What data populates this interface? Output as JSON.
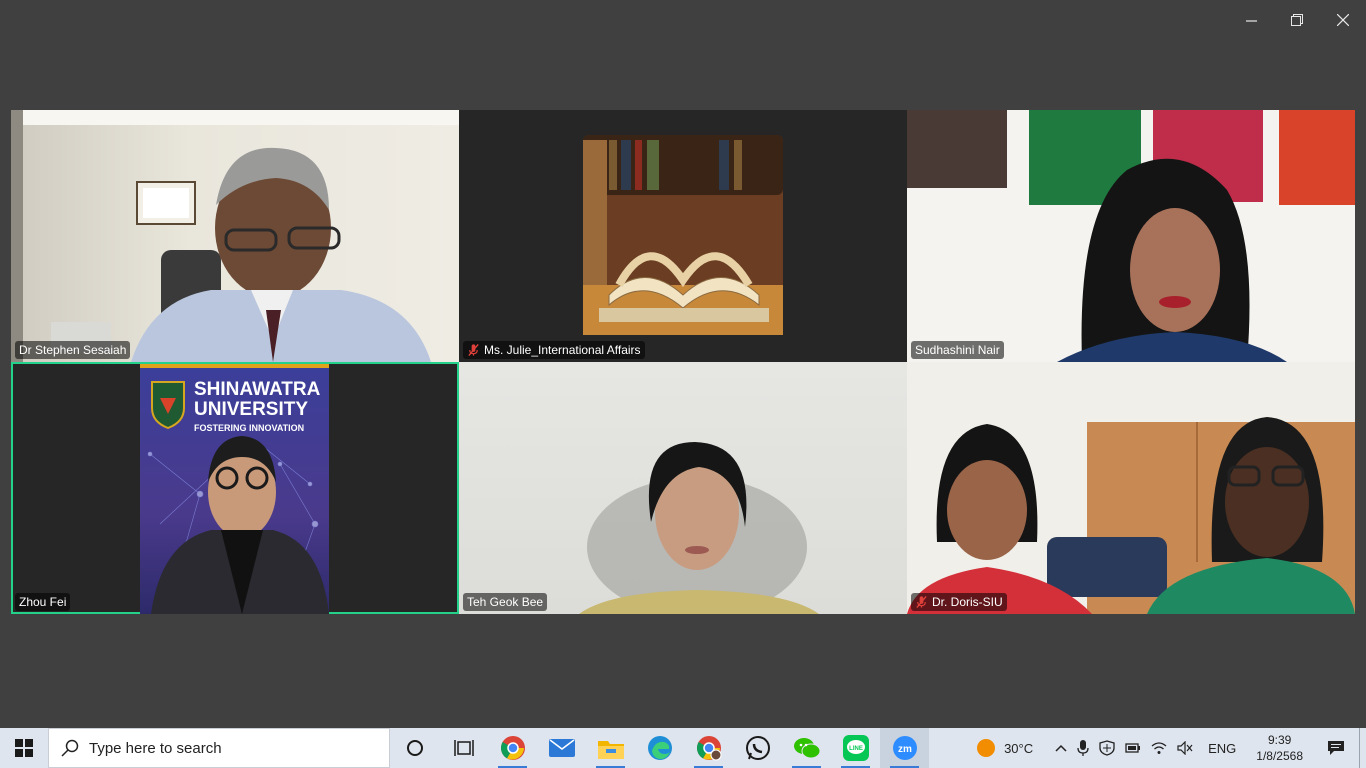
{
  "window": {
    "controls": {
      "minimize": "minimize-icon",
      "restore": "restore-icon",
      "close": "close-icon"
    }
  },
  "participants": [
    {
      "name": "Dr Stephen Sesaiah",
      "muted": false
    },
    {
      "name": "Ms. Julie_International Affairs",
      "muted": true
    },
    {
      "name": "Sudhashini Nair",
      "muted": false
    },
    {
      "name": "Zhou Fei",
      "muted": false,
      "active_speaker": true
    },
    {
      "name": "Teh Geok Bee",
      "muted": false
    },
    {
      "name": "Dr. Doris-SIU",
      "muted": true
    }
  ],
  "banner": {
    "line1": "SHINAWATRA",
    "line2": "UNIVERSITY",
    "line3": "FOSTERING INNOVATION"
  },
  "taskbar": {
    "search_placeholder": "Type here to search",
    "apps": [
      "chrome-icon",
      "mail-icon",
      "file-explorer-icon",
      "edge-icon",
      "chrome-profile-icon",
      "whatsapp-icon",
      "wechat-icon",
      "line-icon",
      "zoom-icon"
    ],
    "weather": "30°C",
    "language": "ENG",
    "time": "9:39",
    "date": "1/8/2568"
  },
  "colors": {
    "active_border": "#23d18b",
    "mute_red": "#e0403a",
    "zoom_blue": "#2d8cff"
  }
}
